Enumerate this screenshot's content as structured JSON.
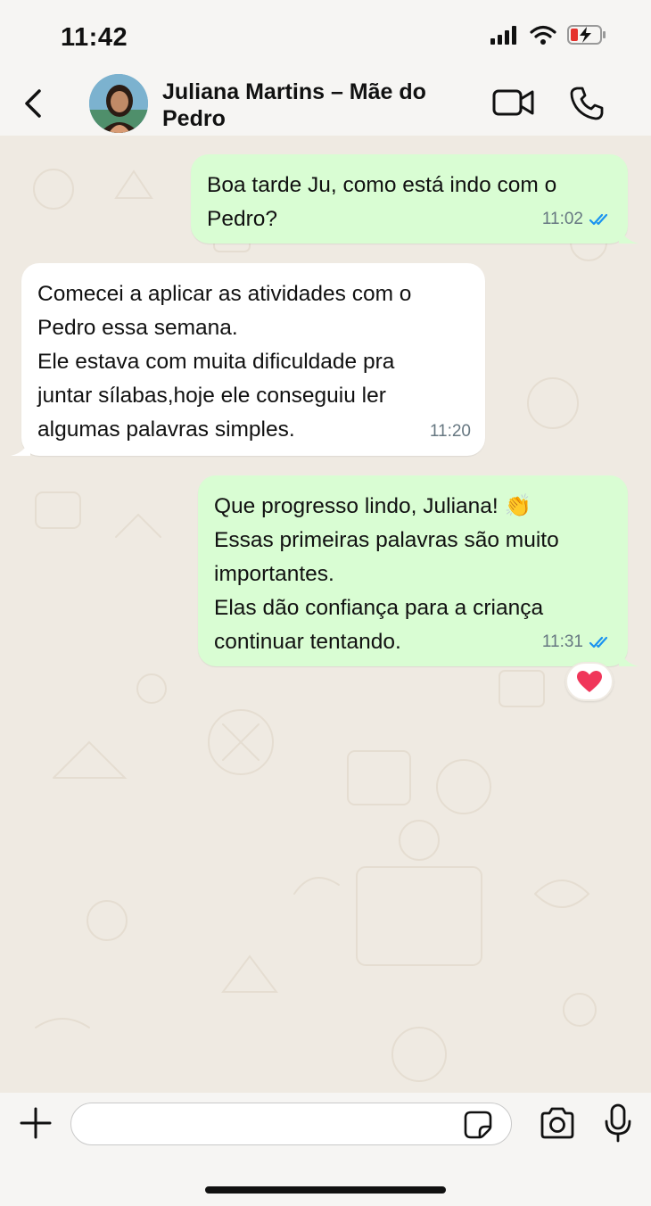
{
  "status_bar": {
    "time": "11:42",
    "icons": [
      "signal-icon",
      "wifi-icon",
      "battery-charging-icon"
    ]
  },
  "header": {
    "contact_name": "Juliana Martins – Mãe do Pedro",
    "icons": [
      "back-icon",
      "avatar",
      "video-call-icon",
      "phone-icon"
    ]
  },
  "messages": [
    {
      "direction": "outgoing",
      "lines": [
        "Boa tarde Ju, como está indo com o",
        "Pedro?"
      ],
      "time": "11:02",
      "status": "read"
    },
    {
      "direction": "incoming",
      "lines": [
        "Comecei a aplicar as atividades com o",
        "Pedro essa semana.",
        "Ele estava com muita dificuldade pra",
        "juntar sílabas,hoje ele conseguiu ler",
        "algumas palavras simples."
      ],
      "time": "11:20"
    },
    {
      "direction": "outgoing",
      "lines": [
        "Que progresso lindo, Juliana! 👏",
        "Essas primeiras palavras são muito",
        "importantes.",
        "Elas dão confiança para a criança",
        "continuar tentando."
      ],
      "time": "11:31",
      "status": "read",
      "reaction": "heart"
    }
  ],
  "composer": {
    "value": "",
    "icons": [
      "plus-icon",
      "sticker-icon",
      "camera-icon",
      "mic-icon"
    ]
  },
  "colors": {
    "outgoing_bubble": "#d9fdd3",
    "incoming_bubble": "#ffffff",
    "chat_background": "#efeae2",
    "read_ticks": "#1a93f0",
    "reaction_heart": "#f0365a"
  }
}
